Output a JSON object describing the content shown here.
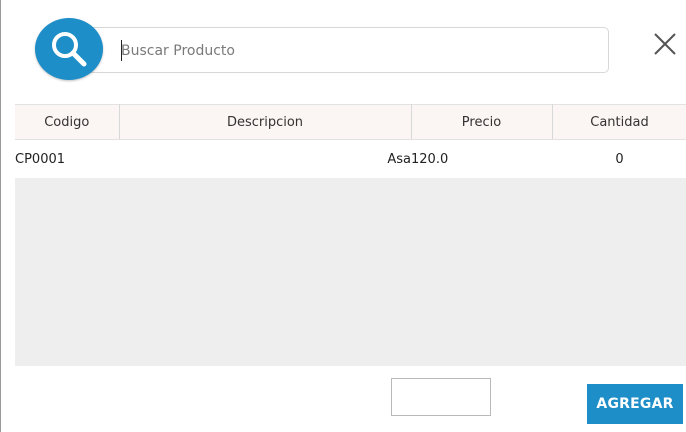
{
  "search": {
    "placeholder": "Buscar Producto",
    "value": ""
  },
  "icons": {
    "search": "search-icon",
    "close": "close-icon"
  },
  "table": {
    "columns": [
      "Codigo",
      "Descripcion",
      "Precio",
      "Cantidad"
    ],
    "rows": [
      {
        "codigo": "CP0001",
        "descripcion": "Asa",
        "precio": "120.0",
        "cantidad": "0"
      }
    ]
  },
  "footer": {
    "quantity_value": "",
    "add_label": "AGREGAR"
  },
  "colors": {
    "accent": "#1e8ec8",
    "header_bg": "#fbf5f3",
    "grid_bg": "#eeeeee"
  }
}
